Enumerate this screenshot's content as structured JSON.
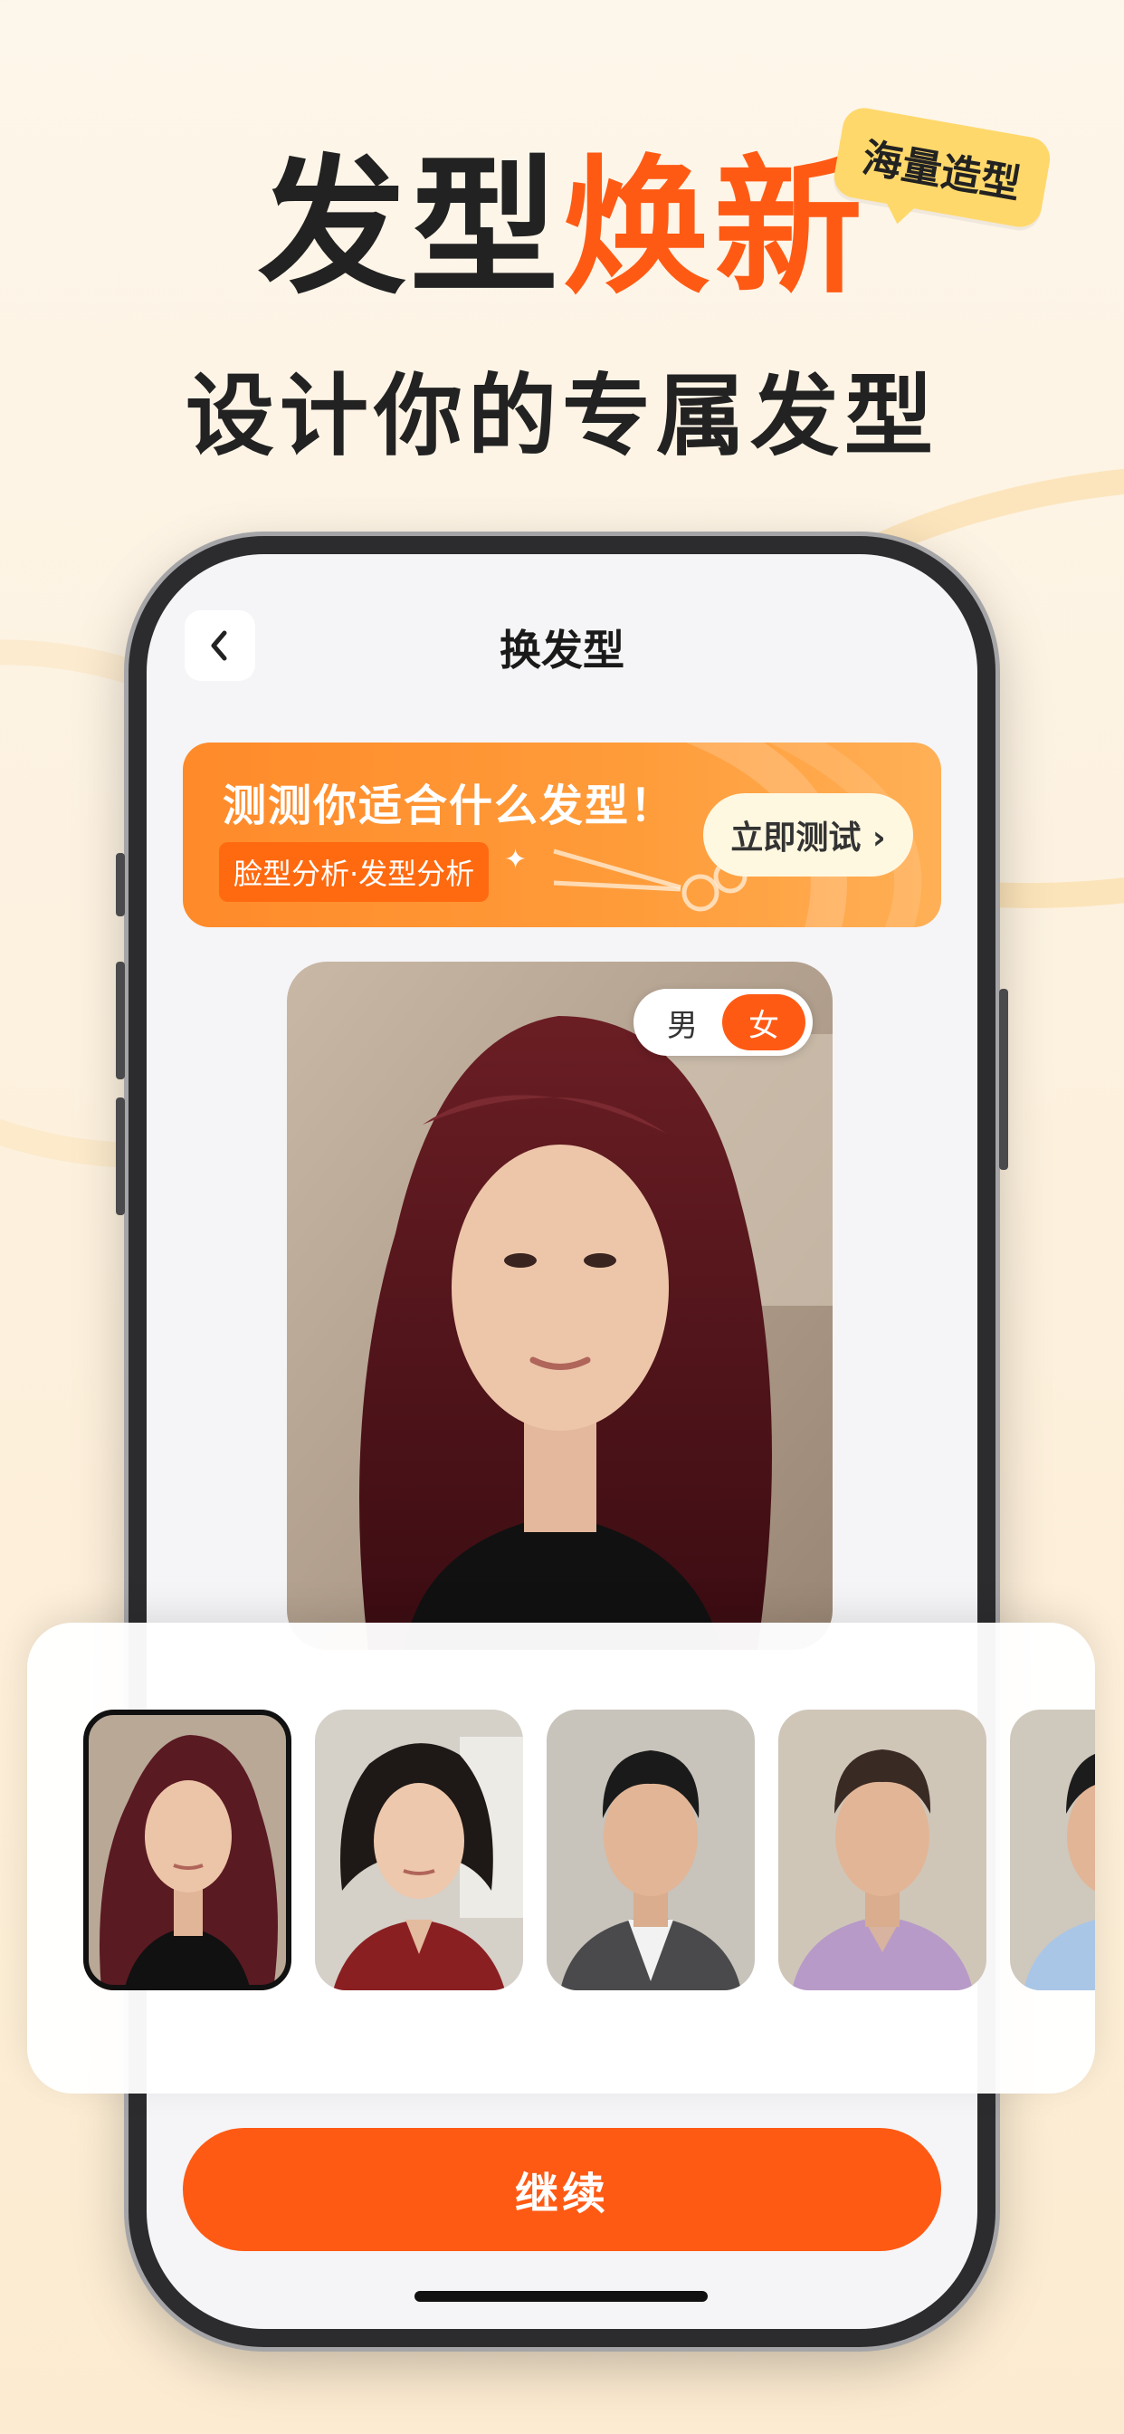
{
  "hero": {
    "title_part1": "发型",
    "title_part2": "焕新",
    "badge": "海量造型",
    "subtitle": "设计你的专属发型"
  },
  "nav": {
    "back_icon": "chevron-left-icon",
    "title": "换发型"
  },
  "banner": {
    "title": "测测你适合什么发型！",
    "tag": "脸型分析·发型分析",
    "cta_label": "立即测试 ›"
  },
  "gender_toggle": {
    "male": "男",
    "female": "女",
    "selected": "女"
  },
  "continue_button": "继续",
  "colors": {
    "accent": "#ff5a14",
    "banner": "#ff9c3a",
    "badge": "#ffd86b"
  },
  "thumbnails": [
    {
      "label": "woman-burgundy-hair",
      "selected": true
    },
    {
      "label": "woman-short-curly-hair",
      "selected": false
    },
    {
      "label": "man-black-suit",
      "selected": false
    },
    {
      "label": "man-purple-shirt",
      "selected": false
    },
    {
      "label": "man-blue-shirt-partial",
      "selected": false
    }
  ]
}
